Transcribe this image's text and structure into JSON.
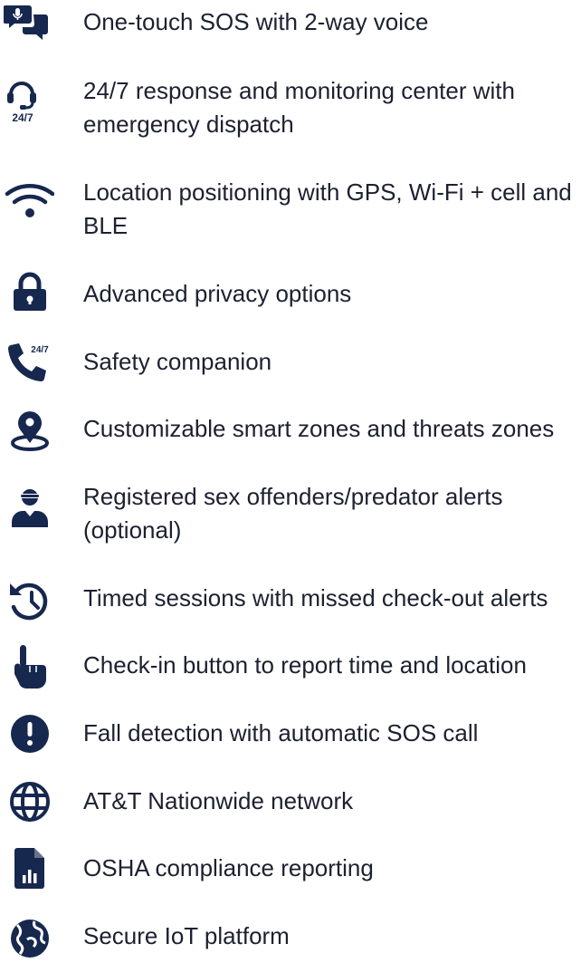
{
  "colors": {
    "icon": "#17284f",
    "text": "#1c2130",
    "background": "#ffffff"
  },
  "features": [
    {
      "icon": "chat-mic-icon",
      "label": "One-touch SOS with 2-way voice"
    },
    {
      "icon": "headset-24-7-icon",
      "label": "24/7 response and monitoring center with emergency dispatch",
      "icon_text": "24/7"
    },
    {
      "icon": "wifi-icon",
      "label": "Location positioning with GPS, Wi-Fi + cell and BLE"
    },
    {
      "icon": "lock-icon",
      "label": "Advanced privacy options"
    },
    {
      "icon": "phone-24-7-icon",
      "label": "Safety companion",
      "icon_text": "24/7"
    },
    {
      "icon": "map-pin-zone-icon",
      "label": "Customizable smart zones and threats zones"
    },
    {
      "icon": "masked-person-icon",
      "label": "Registered sex offenders/predator alerts (optional)"
    },
    {
      "icon": "history-clock-icon",
      "label": "Timed sessions with missed check-out alerts"
    },
    {
      "icon": "pointing-hand-icon",
      "label": "Check-in button to report time and location"
    },
    {
      "icon": "exclamation-circle-icon",
      "label": "Fall detection with automatic SOS call"
    },
    {
      "icon": "globe-icon",
      "label": "AT&T Nationwide network"
    },
    {
      "icon": "report-chart-file-icon",
      "label": "OSHA compliance reporting"
    },
    {
      "icon": "earth-icon",
      "label": "Secure IoT platform"
    }
  ]
}
